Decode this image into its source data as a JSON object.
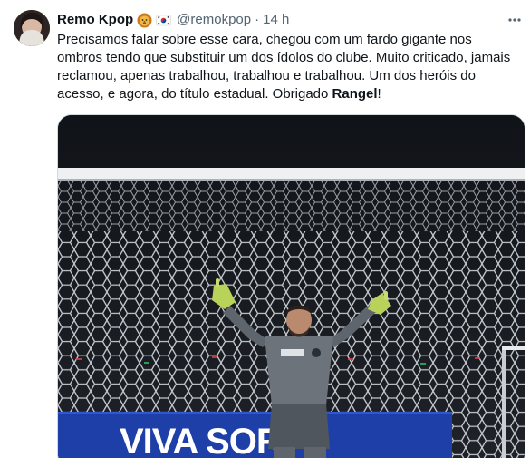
{
  "author": {
    "display_name": "Remo Kpop",
    "badge_emojis": [
      "lion-face-emoji",
      "south-korea-flag-emoji"
    ],
    "handle": "@remokpop",
    "separator": "·",
    "time": "14 h"
  },
  "tweet": {
    "text_before_bold": "Precisamos falar sobre esse cara, chegou com um fardo gigante nos ombros tendo que substituir um dos ídolos do clube. Muito criticado, jamais reclamou, apenas trabalhou, trabalhou e trabalhou. Um dos heróis do acesso, e agora, do título estadual. Obrigado ",
    "bold_text": "Rangel",
    "text_after_bold": "!"
  },
  "media": {
    "banner_text": "VIVA SORTE",
    "colors": {
      "banner": "#1f3fa8",
      "banner_text": "#ffffff",
      "kit": "#6c737a",
      "gloves": "#b9d25a",
      "net": "#d8dde2",
      "night": "#15181d"
    }
  },
  "colors": {
    "text": "#0f1419",
    "secondary_text": "#536471",
    "border": "#cfd9de",
    "background": "#ffffff"
  }
}
